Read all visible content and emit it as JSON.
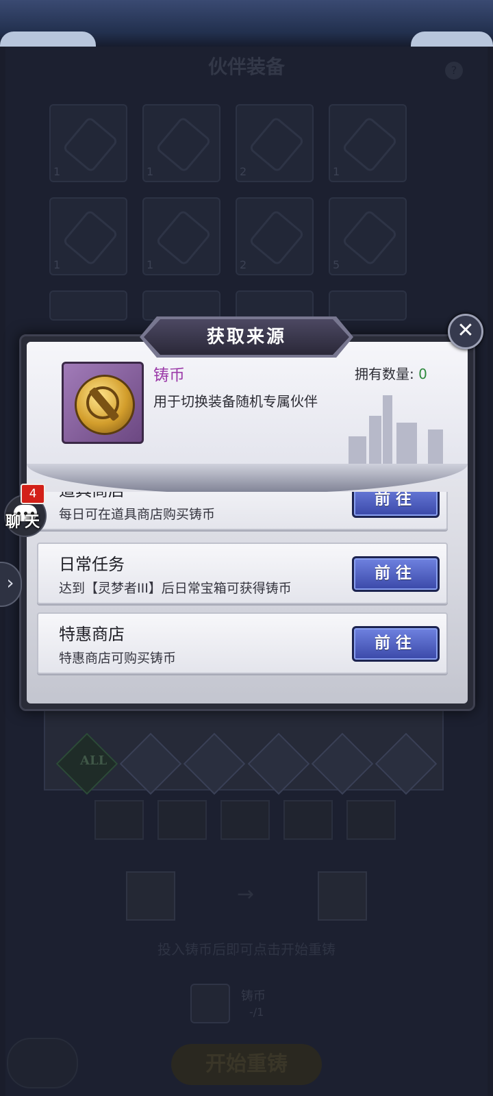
{
  "background": {
    "title": "伙伴装备",
    "slot_counts": [
      "1",
      "1",
      "2",
      "1",
      "1",
      "1",
      "2",
      "5"
    ],
    "element_all_label": "ALL",
    "hint": "投入铸币后即可点击开始重铸",
    "coin_slot_label": "铸币",
    "coin_slot_count": "-/1",
    "start_button": "开始重铸"
  },
  "chat": {
    "badge": "4",
    "label": "聊天"
  },
  "modal": {
    "title": "获取来源",
    "close_icon": "close-icon",
    "item": {
      "name": "铸币",
      "description": "用于切换装备随机专属伙伴",
      "owned_label": "拥有数量:",
      "owned_count": "0"
    },
    "sources": [
      {
        "name": "道具商店",
        "desc": "每日可在道具商店购买铸币",
        "button": "前往"
      },
      {
        "name": "日常任务",
        "desc": "达到【灵梦者III】后日常宝箱可获得铸币",
        "button": "前往"
      },
      {
        "name": "特惠商店",
        "desc": "特惠商店可购买铸币",
        "button": "前往"
      }
    ]
  },
  "colors": {
    "item_name": "#9b3aa8",
    "owned_count": "#2f8a3e",
    "go_button": "#4a5ac4"
  }
}
